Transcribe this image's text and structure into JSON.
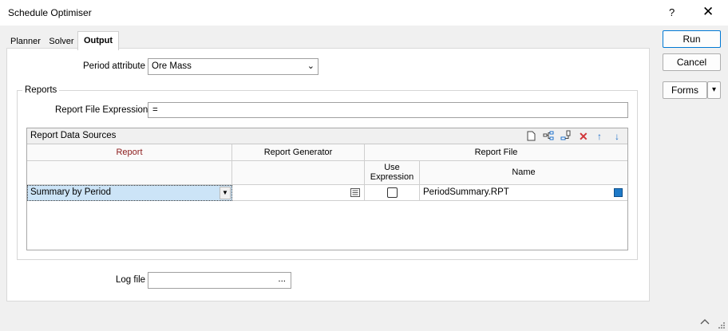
{
  "window": {
    "title": "Schedule Optimiser",
    "help": "?",
    "close": "✕"
  },
  "tabs": [
    {
      "label": "Planner",
      "active": false
    },
    {
      "label": "Solver",
      "active": false
    },
    {
      "label": "Output",
      "active": true
    }
  ],
  "buttons": {
    "run": "Run",
    "cancel": "Cancel",
    "forms": "Forms",
    "forms_arrow": "▾"
  },
  "period_attribute": {
    "label": "Period attribute",
    "value": "Ore Mass"
  },
  "reports": {
    "group_label": "Reports",
    "file_expression_label": "Report File Expression",
    "file_expression_value": "=",
    "data_sources": {
      "title": "Report Data Sources",
      "columns": {
        "report": "Report",
        "generator": "Report Generator",
        "file": "Report File",
        "use_expression": "Use Expression",
        "name": "Name"
      },
      "rows": [
        {
          "report": "Summary by Period",
          "generator": "",
          "use_expression": false,
          "name": "PeriodSummary.RPT"
        }
      ],
      "toolbar_icons": [
        "new-file-icon",
        "tree-icon",
        "insert-icon",
        "delete-icon",
        "move-up-icon",
        "move-down-icon"
      ]
    }
  },
  "log_file": {
    "label": "Log file",
    "value": "",
    "browse": "..."
  },
  "colors": {
    "selected_row": "#cce4f7",
    "report_header": "#8b1a1a",
    "accent": "#0078d4",
    "swatch": "#1e7ac8"
  }
}
